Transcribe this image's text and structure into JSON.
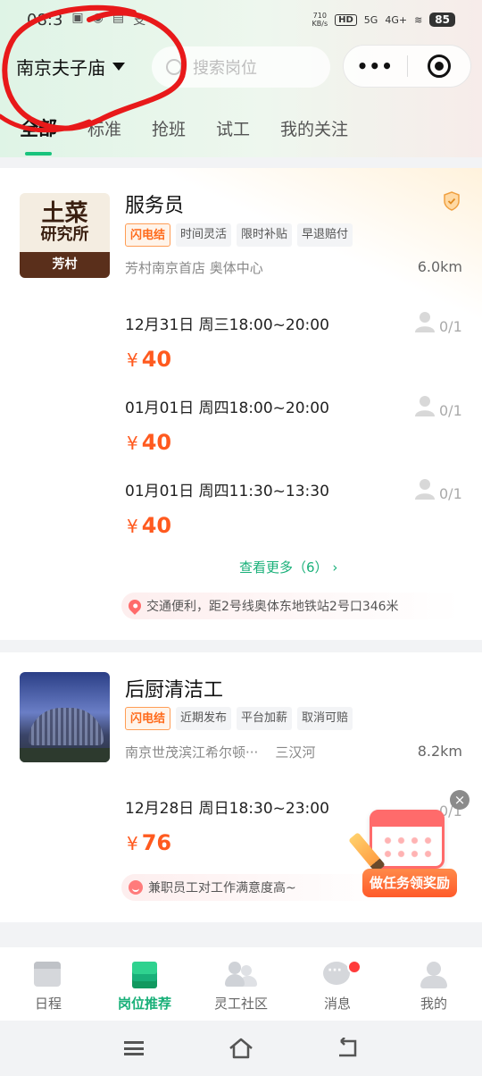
{
  "status_bar": {
    "time": "08:3",
    "net_speed_top": "710",
    "net_speed_bottom": "KB/s",
    "hd_label": "HD",
    "signal1": "5G",
    "signal2": "4G+",
    "battery": "85"
  },
  "header": {
    "city": "南京夫子庙",
    "search_placeholder": "搜索岗位",
    "capsule_more": "•••"
  },
  "tabs": [
    {
      "label": "全部"
    },
    {
      "label": "标准"
    },
    {
      "label": "抢班"
    },
    {
      "label": "试工"
    },
    {
      "label": "我的关注"
    }
  ],
  "jobs": [
    {
      "logo": {
        "line1": "土菜",
        "line2": "研究所",
        "brand": "芳村"
      },
      "title": "服务员",
      "tags": [
        "闪电结",
        "时间灵活",
        "限时补贴",
        "早退赔付"
      ],
      "location": "芳村南京首店  奥体中心",
      "distance": "6.0km",
      "shifts": [
        {
          "time": "12月31日 周三18:00~20:00",
          "price": "40",
          "count": "0/1"
        },
        {
          "time": "01月01日 周四18:00~20:00",
          "price": "40",
          "count": "0/1"
        },
        {
          "time": "01月01日 周四11:30~13:30",
          "price": "40",
          "count": "0/1"
        }
      ],
      "more": "查看更多（6）",
      "note": "交通便利，距2号线奥体东地铁站2号口346米"
    },
    {
      "title": "后厨清洁工",
      "tags": [
        "闪电结",
        "近期发布",
        "平台加薪",
        "取消可赔"
      ],
      "location": "南京世茂滨江希尔顿···",
      "area": "三汉河",
      "distance": "8.2km",
      "shifts": [
        {
          "time": "12月28日 周日18:30~23:00",
          "price": "76",
          "count": "0/1"
        }
      ],
      "note": "兼职员工对工作满意度高~"
    }
  ],
  "currency": "¥",
  "promo": {
    "button": "做任务领奖励",
    "close": "×"
  },
  "bottom_nav": [
    {
      "label": "日程",
      "icon": "calendar-icon"
    },
    {
      "label": "岗位推荐",
      "icon": "layers-icon"
    },
    {
      "label": "灵工社区",
      "icon": "people-icon"
    },
    {
      "label": "消息",
      "icon": "chat-icon"
    },
    {
      "label": "我的",
      "icon": "user-icon"
    }
  ],
  "colors": {
    "accent_green": "#19b079",
    "price_orange": "#ff5a1f",
    "flash_tag": "#ff6a1a",
    "annotation_red": "#e8191a"
  }
}
